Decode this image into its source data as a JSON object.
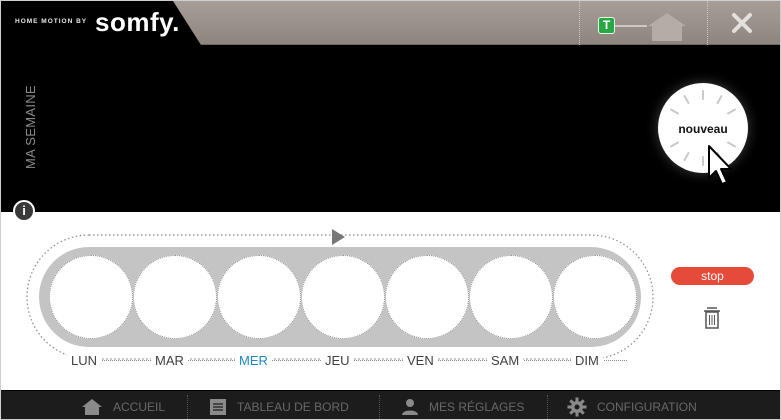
{
  "header": {
    "brand_small": "HOME MOTION BY",
    "brand_name": "somfy.",
    "badge_letter": "T"
  },
  "panel": {
    "side_title": "MA SEMAINE",
    "new_button": "nouveau"
  },
  "week": {
    "days": [
      {
        "label": "LUN",
        "active": false
      },
      {
        "label": "MAR",
        "active": false
      },
      {
        "label": "MER",
        "active": true
      },
      {
        "label": "JEU",
        "active": false
      },
      {
        "label": "VEN",
        "active": false
      },
      {
        "label": "SAM",
        "active": false
      },
      {
        "label": "DIM",
        "active": false
      }
    ]
  },
  "actions": {
    "stop_label": "stop"
  },
  "footer": {
    "items": [
      {
        "label": "ACCUEIL",
        "icon": "house-icon"
      },
      {
        "label": "TABLEAU DE BORD",
        "icon": "dashboard-icon"
      },
      {
        "label": "MES RÉGLAGES",
        "icon": "user-icon"
      },
      {
        "label": "CONFIGURATION",
        "icon": "gear-icon"
      }
    ]
  },
  "colors": {
    "accent_blue": "#1a87c7",
    "stop_red": "#e64a3b",
    "badge_green": "#27a844"
  }
}
